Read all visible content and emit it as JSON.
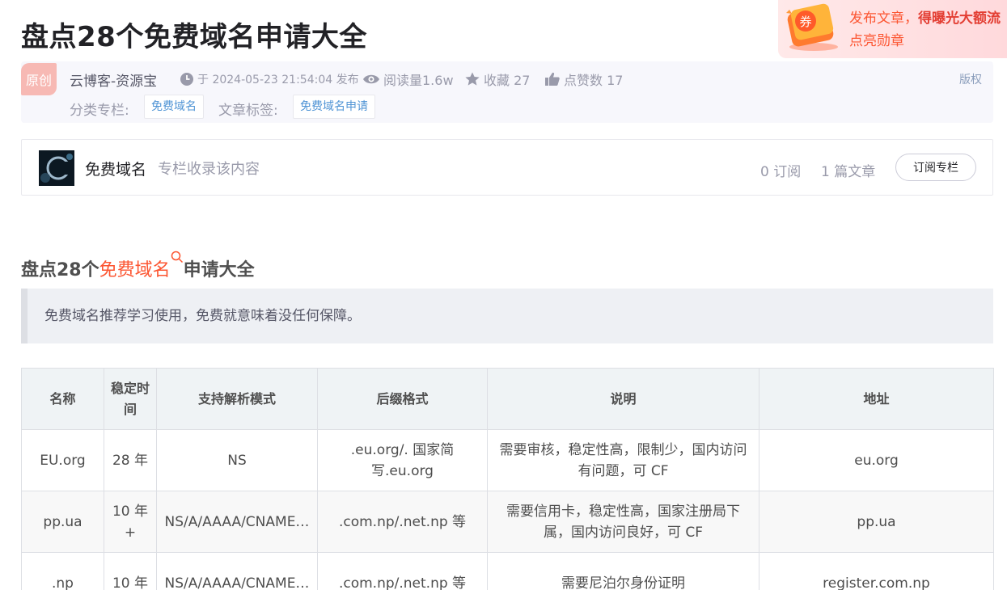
{
  "article": {
    "title": "盘点28个免费域名申请大全",
    "original_badge": "原创",
    "author": "云博客-资源宝",
    "publish_time": "于 2024-05-23 21:54:04 发布",
    "read_count": "阅读量1.6w",
    "favorites": "收藏 27",
    "likes": "点赞数 17",
    "copyright": "版权",
    "category_label": "分类专栏:",
    "category_tag": "免费域名",
    "tags_label": "文章标签:",
    "tag": "免费域名申请"
  },
  "promo": {
    "coupon_char": "券",
    "line1_prefix": "发布文章，",
    "line1_bold": "得曝光大额流",
    "line2": "点亮勋章"
  },
  "column": {
    "name": "免费域名",
    "desc": "专栏收录该内容",
    "subscribers": "0 订阅",
    "articles": "1 篇文章",
    "subscribe_button": "订阅专栏"
  },
  "content": {
    "heading_prefix": "盘点28个",
    "heading_keyword": "免费域名",
    "heading_suffix": "申请大全",
    "quote": "免费域名推荐学习使用，免费就意味着没任何保障。"
  },
  "table": {
    "headers": [
      "名称",
      "稳定时间",
      "支持解析模式",
      "后缀格式",
      "说明",
      "地址"
    ],
    "rows": [
      [
        "EU.org",
        "28 年",
        "NS",
        ".eu.org/. 国家简写.eu.org",
        "需要审核，稳定性高，限制少，国内访问有问题，可 CF",
        "eu.org"
      ],
      [
        "pp.ua",
        "10 年 +",
        "NS/A/AAAA/CNAME…",
        ".com.np/.net.np 等",
        "需要信用卡，稳定性高，国家注册局下属，国内访问良好，可 CF",
        "pp.ua"
      ],
      [
        ".np",
        "10 年",
        "NS/A/AAAA/CNAME…",
        ".com.np/.net.np 等",
        "需要尼泊尔身份证明",
        "register.com.np"
      ]
    ]
  },
  "colors": {
    "accent": "#fc5531",
    "tag_text": "#5094d5",
    "muted": "#999aaa"
  }
}
